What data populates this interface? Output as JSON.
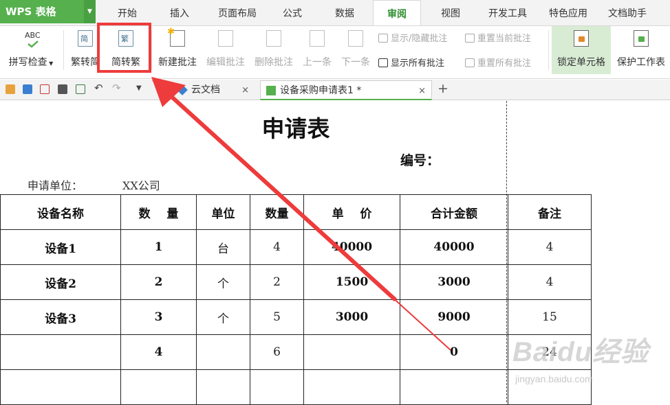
{
  "app": {
    "name": "WPS 表格",
    "brand_color": "#55b04d",
    "arrow_color": "#ee3b3b"
  },
  "ribbon_tabs": [
    {
      "label": "开始",
      "active": false
    },
    {
      "label": "插入",
      "active": false
    },
    {
      "label": "页面布局",
      "active": false
    },
    {
      "label": "公式",
      "active": false
    },
    {
      "label": "数据",
      "active": false
    },
    {
      "label": "审阅",
      "active": true
    },
    {
      "label": "视图",
      "active": false
    },
    {
      "label": "开发工具",
      "active": false
    },
    {
      "label": "特色应用",
      "active": false
    },
    {
      "label": "文档助手",
      "active": false
    }
  ],
  "ribbon": {
    "spell_check": {
      "icon_text": "ABC",
      "label": "拼写检查"
    },
    "trad_to_simp": "繁转简",
    "simp_to_trad": "简转繁",
    "trad_icon_char": "繁",
    "simp_icon_char": "简",
    "new_comment": "新建批注",
    "edit_comment": "编辑批注",
    "delete_comment": "删除批注",
    "prev": "上一条",
    "next": "下一条",
    "show_hide_comment": "显示/隐藏批注",
    "show_all_comments": "显示所有批注",
    "reset_current_comment": "重置当前批注",
    "reset_all_comments": "重置所有批注",
    "lock_cell": "锁定单元格",
    "protect_sheet": "保护工作表"
  },
  "doc_tabs": [
    {
      "label": "云文档",
      "active": false,
      "close": "×"
    },
    {
      "label": "设备采购申请表1 *",
      "active": true,
      "close": "×"
    }
  ],
  "new_tab_symbol": "+",
  "sheet": {
    "title": "申请表",
    "serial_label": "编号：",
    "unit_label": "申请单位：",
    "unit_value": "XX公司",
    "headers": [
      "设备名称",
      "数    量",
      "单位",
      "数量",
      "单    价",
      "合计金额",
      "备注"
    ],
    "rows": [
      [
        "设备1",
        "1",
        "台",
        "4",
        "40000",
        "40000",
        "4"
      ],
      [
        "设备2",
        "2",
        "个",
        "2",
        "1500",
        "3000",
        "4"
      ],
      [
        "设备3",
        "3",
        "个",
        "5",
        "3000",
        "9000",
        "15"
      ],
      [
        "",
        "4",
        "",
        "6",
        "",
        "0",
        "24"
      ],
      [
        "",
        "",
        "",
        "",
        "",
        "",
        ""
      ]
    ]
  },
  "watermark": {
    "line1": "Baidu经验",
    "line2": "jingyan.baidu.com"
  }
}
